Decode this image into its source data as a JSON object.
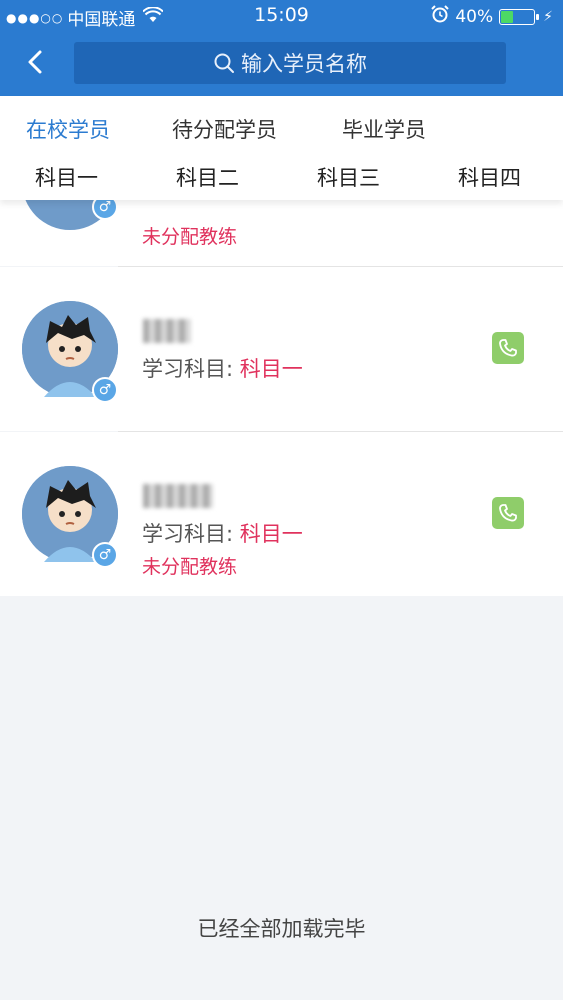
{
  "status_bar": {
    "signal_dots": "●●●○○",
    "carrier": "中国联通",
    "time": "15:09",
    "battery_percent_text": "40%",
    "battery_level": 0.4,
    "battery_color": "#4cd964"
  },
  "nav": {
    "back_icon": "chevron-left-icon",
    "search_placeholder": "输入学员名称"
  },
  "tabs": {
    "main": [
      {
        "label": "在校学员",
        "active": true
      },
      {
        "label": "待分配学员",
        "active": false
      },
      {
        "label": "毕业学员",
        "active": false
      }
    ],
    "subjects": [
      "科目一",
      "科目二",
      "科目三",
      "科目四"
    ]
  },
  "students": [
    {
      "subject_label": "",
      "subject_value": "",
      "coach_status": "未分配教练",
      "gender_icon": "male-icon"
    },
    {
      "subject_label": "学习科目: ",
      "subject_value": "科目一",
      "coach_status": "",
      "gender_icon": "male-icon"
    },
    {
      "subject_label": "学习科目: ",
      "subject_value": "科目一",
      "coach_status": "未分配教练",
      "gender_icon": "male-icon"
    }
  ],
  "footer": {
    "loaded_text": "已经全部加载完毕"
  },
  "colors": {
    "header": "#2b7bd0",
    "accent_red": "#e0325d",
    "phone_green": "#8fcd6a"
  }
}
